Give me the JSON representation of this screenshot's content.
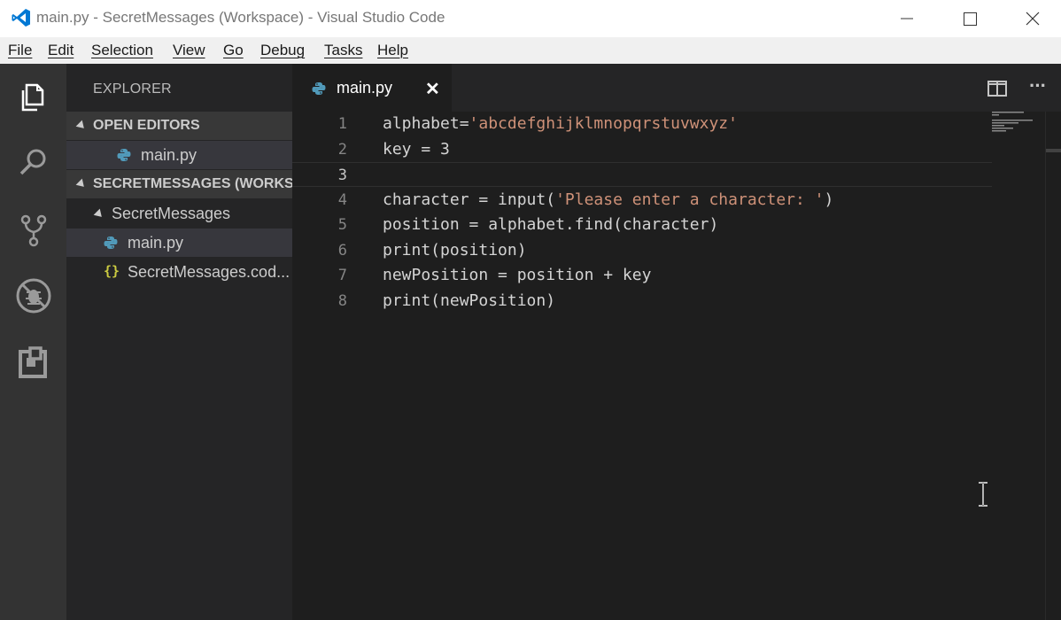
{
  "window": {
    "title": "main.py - SecretMessages (Workspace) - Visual Studio Code"
  },
  "menu": [
    "File",
    "Edit",
    "Selection",
    "View",
    "Go",
    "Debug",
    "Tasks",
    "Help"
  ],
  "activity_bar": {
    "icons": [
      "explorer-icon",
      "search-icon",
      "source-control-icon",
      "debug-icon",
      "extensions-icon"
    ]
  },
  "sidebar": {
    "title": "EXPLORER",
    "open_editors": {
      "label": "OPEN EDITORS",
      "items": [
        "main.py"
      ]
    },
    "workspace": {
      "label": "SECRETMESSAGES (WORKS...",
      "folder": "SecretMessages",
      "files": [
        "main.py",
        "SecretMessages.cod..."
      ]
    }
  },
  "editor": {
    "tab_label": "main.py",
    "tab_close": "✕",
    "more_actions": "···",
    "line_numbers": [
      "1",
      "2",
      "3",
      "4",
      "5",
      "6",
      "7",
      "8"
    ],
    "current_line": 3,
    "lines": [
      {
        "code": "alphabet=",
        "string": "'abcdefghijklmnopqrstuvwxyz'",
        "rest": ""
      },
      {
        "code": "key = 3",
        "string": "",
        "rest": ""
      },
      {
        "code": "",
        "string": "",
        "rest": ""
      },
      {
        "code": "character = input(",
        "string": "'Please enter a character: '",
        "rest": ")"
      },
      {
        "code": "position = alphabet.find(character)",
        "string": "",
        "rest": ""
      },
      {
        "code": "print(position)",
        "string": "",
        "rest": ""
      },
      {
        "code": "newPosition = position + key",
        "string": "",
        "rest": ""
      },
      {
        "code": "print(newPosition)",
        "string": "",
        "rest": ""
      }
    ]
  },
  "colors": {
    "accent": "#007acc",
    "string": "#ce9178",
    "python_icon": "#519aba",
    "json_icon": "#cbcb41"
  }
}
